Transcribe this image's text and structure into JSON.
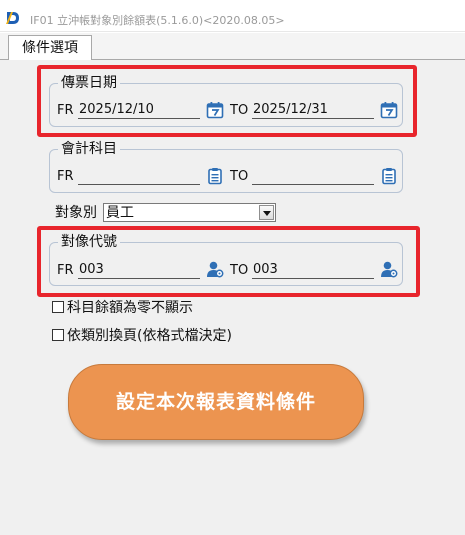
{
  "window": {
    "title": "IF01 立沖帳對象別餘額表(5.1.6.0)<2020.08.05>"
  },
  "tabs": [
    {
      "label": "條件選項",
      "selected": true
    }
  ],
  "voucher_date": {
    "title": "傳票日期",
    "from_label": "FR",
    "from_value": "2025/12/10",
    "to_label": "TO",
    "to_value": "2025/12/31",
    "icon": "calendar-icon"
  },
  "account_subject": {
    "title": "會計科目",
    "from_label": "FR",
    "from_value": "",
    "to_label": "TO",
    "to_value": "",
    "icon": "clipboard-icon"
  },
  "object_type": {
    "label": "對象別",
    "selected": "員工"
  },
  "object_code": {
    "title": "對像代號",
    "from_label": "FR",
    "from_value": "003",
    "to_label": "TO",
    "to_value": "003",
    "icon": "user-search-icon"
  },
  "options": [
    {
      "label": "科目餘額為零不顯示",
      "checked": false
    },
    {
      "label": "依類別換頁(依格式檔決定)",
      "checked": false
    }
  ],
  "submit_button": {
    "label": "設定本次報表資料條件"
  },
  "colors": {
    "highlight": "#e8252c",
    "button": "#ec9450",
    "icon_blue": "#2f6fb5",
    "background": "#f0f0f0"
  }
}
